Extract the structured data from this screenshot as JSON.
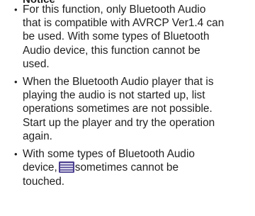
{
  "heading": "Notice",
  "notes": [
    {
      "lines": [
        "For this function, only Bluetooth Audio",
        "that is compatible with AVRCP Ver1.4 can",
        "be used. With some types of Bluetooth",
        "Audio device, this function cannot be",
        "used."
      ]
    },
    {
      "lines": [
        "When the Bluetooth Audio player that is",
        "playing the audio is not started up, list",
        "operations sometimes are not possible.",
        "Start up the player and try the operation",
        "again."
      ]
    },
    {
      "line1": "With some types of Bluetooth Audio",
      "line2_before": "device,",
      "line2_after": "sometimes cannot be",
      "line3": "touched.",
      "icon": "list-icon"
    }
  ],
  "bullet": "•"
}
